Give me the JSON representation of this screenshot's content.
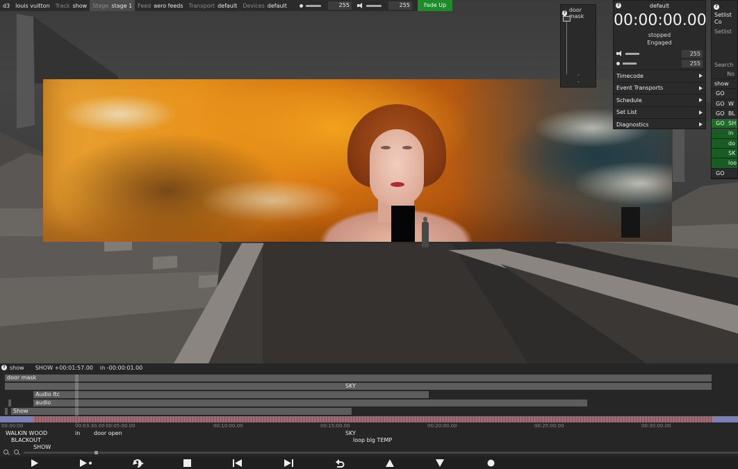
{
  "topbar": {
    "app": "d3",
    "project": "louis vuitton",
    "track_key": "Track",
    "track_val": "show",
    "stage_key": "Stage",
    "stage_val": "stage 1",
    "feed_key": "Feed",
    "feed_val": "aero feeds",
    "transport_key": "Transport",
    "transport_val": "default",
    "devices_key": "Devices",
    "devices_val": "default",
    "brightness_value": "255",
    "volume_value": "255",
    "fade_up_label": "Fade Up"
  },
  "door_mask_panel": {
    "title": "door mask",
    "tick1": "-",
    "tick2": "-"
  },
  "transport_panel": {
    "title": "default",
    "timecode": "00:00:00.00",
    "status1": "stopped",
    "status2": "Engaged",
    "volume_value": "255",
    "brightness_value": "255",
    "menu": [
      "Timecode",
      "Event Transports",
      "Schedule",
      "Set List",
      "Diagnostics"
    ]
  },
  "setlist_panel": {
    "title": "Setlist Co",
    "sub": "Setlist",
    "search": "Search",
    "col_header": "No",
    "rows": [
      {
        "go": "",
        "name": "show"
      },
      {
        "go": "GO",
        "name": ""
      },
      {
        "go": "GO",
        "name": "W"
      },
      {
        "go": "GO",
        "name": "BL"
      },
      {
        "go": "GO",
        "name": "SH"
      },
      {
        "go": "",
        "name": "in"
      },
      {
        "go": "",
        "name": "do"
      },
      {
        "go": "",
        "name": "SK"
      },
      {
        "go": "",
        "name": "loo"
      },
      {
        "go": "GO",
        "name": ""
      }
    ]
  },
  "timeline": {
    "track_name": "show",
    "position": "SHOW +00:01:57.00",
    "remaining": "in -00:00:01.00",
    "layers": {
      "door_mask": "door mask",
      "sky": "SKY",
      "audio_ltc": "Audio  ltc",
      "audio": "audio",
      "show": "Show"
    },
    "ticks": [
      "00:00:00",
      "00:03:30.00",
      "00:05:00.00",
      "00:10:00.00",
      "00:15:00.00",
      "00:20:00.00",
      "00:25:00.00",
      "00:30:00.00"
    ],
    "cues": {
      "walkin": "WALKIN WOOD",
      "blackout": "BLACKOUT",
      "show": "SHOW",
      "in": "in",
      "door_open": "door open",
      "sky": "SKY",
      "loop": "loop blg TEMP"
    },
    "controls": [
      "play-icon",
      "play-to-next-icon",
      "loop-icon",
      "stop-icon",
      "previous-section-icon",
      "next-section-icon",
      "return-icon",
      "triangle-up-icon",
      "triangle-down-icon",
      "record-dot-icon"
    ]
  }
}
